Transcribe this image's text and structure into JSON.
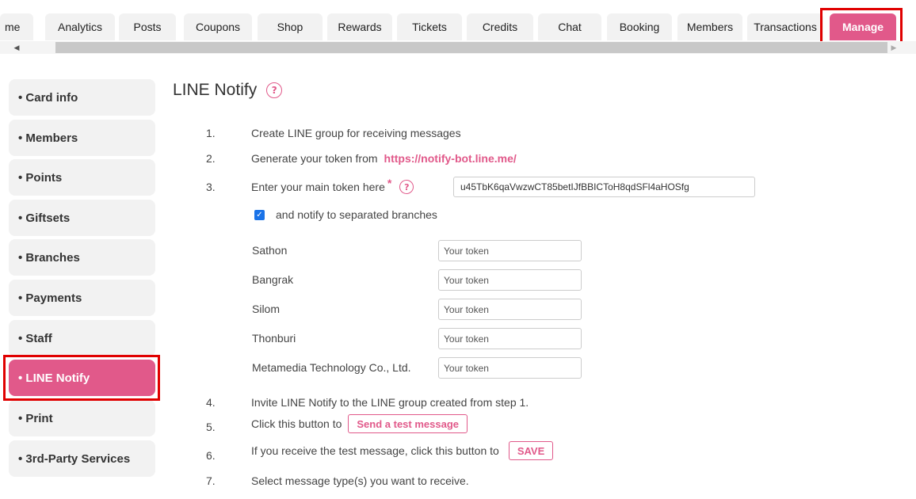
{
  "tabs": [
    {
      "label": "me"
    },
    {
      "label": "Analytics"
    },
    {
      "label": "Posts"
    },
    {
      "label": "Coupons"
    },
    {
      "label": "Shop"
    },
    {
      "label": "Rewards"
    },
    {
      "label": "Tickets"
    },
    {
      "label": "Credits"
    },
    {
      "label": "Chat"
    },
    {
      "label": "Booking"
    },
    {
      "label": "Members"
    },
    {
      "label": "Transactions"
    },
    {
      "label": "Manage"
    }
  ],
  "active_tab": "Manage",
  "sidebar": {
    "items": [
      {
        "label": "• Card info"
      },
      {
        "label": "• Members"
      },
      {
        "label": "• Points"
      },
      {
        "label": "• Giftsets"
      },
      {
        "label": "• Branches"
      },
      {
        "label": "• Payments"
      },
      {
        "label": "• Staff"
      },
      {
        "label": "• LINE Notify"
      },
      {
        "label": "• Print"
      },
      {
        "label": "• 3rd-Party Services"
      }
    ],
    "active": "• LINE Notify"
  },
  "main": {
    "title": "LINE Notify",
    "steps": {
      "s1": {
        "num": "1.",
        "text": "Create LINE group for receiving messages"
      },
      "s2": {
        "num": "2.",
        "text": "Generate your token from",
        "link": "https://notify-bot.line.me/"
      },
      "s3": {
        "num": "3.",
        "text": "Enter your main token here",
        "required_mark": "*",
        "token_value": "u45TbK6qaVwzwCT85betIJfBBICToH8qdSFl4aHOSfg"
      },
      "s4": {
        "num": "4.",
        "text": "Invite LINE Notify to the LINE group created from step 1."
      },
      "s5": {
        "num": "5.",
        "text": "Click this button to",
        "button": "Send a test message"
      },
      "s6": {
        "num": "6.",
        "text": "If you receive the test message, click this button to",
        "button": "SAVE"
      },
      "s7": {
        "num": "7.",
        "text": "Select message type(s) you want to receive."
      }
    },
    "separate_branches": {
      "label": "and notify to separated branches",
      "checked": true
    },
    "branches": [
      {
        "name": "Sathon",
        "placeholder": "Your token"
      },
      {
        "name": "Bangrak",
        "placeholder": "Your token"
      },
      {
        "name": "Silom",
        "placeholder": "Your token"
      },
      {
        "name": "Thonburi",
        "placeholder": "Your token"
      },
      {
        "name": "Metamedia Technology Co., Ltd.",
        "placeholder": "Your token"
      }
    ]
  },
  "colors": {
    "accent": "#e1598a",
    "highlight": "#e00000",
    "tab_bg": "#f2f2f2",
    "checkbox": "#1a73e8"
  },
  "icons": {
    "help": "question-circle-icon",
    "check": "check-icon",
    "scroll_left": "chevron-left-icon",
    "scroll_right": "chevron-right-icon"
  }
}
